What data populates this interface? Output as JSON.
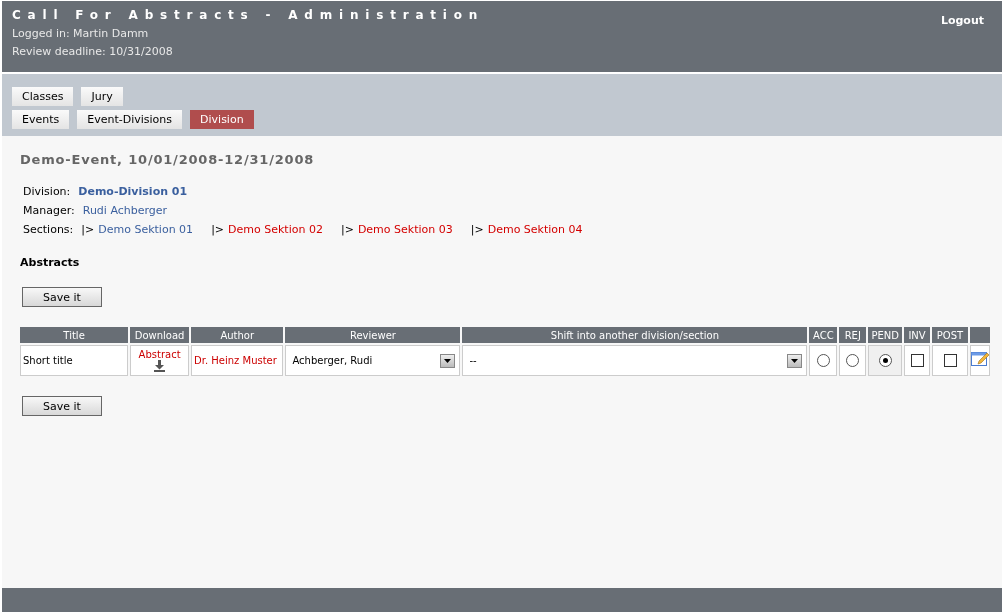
{
  "header": {
    "title": "Call For Abstracts - Administration",
    "logged_in": "Logged in: Martin Damm",
    "deadline": "Review deadline: 10/31/2008",
    "logout": "Logout"
  },
  "nav": [
    [
      {
        "label": "Classes",
        "selected": false
      },
      {
        "label": "Jury",
        "selected": false
      }
    ],
    [
      {
        "label": "Events",
        "selected": false
      },
      {
        "label": "Event-Divisions",
        "selected": false
      },
      {
        "label": "Division",
        "selected": true
      }
    ]
  ],
  "event_title": "Demo-Event, 10/01/2008-12/31/2008",
  "division": {
    "label": "Division:",
    "value": "Demo-Division 01"
  },
  "manager": {
    "label": "Manager:",
    "value": "Rudi Achberger"
  },
  "sections": {
    "label": "Sections:",
    "items": [
      {
        "marker": "|>",
        "name": "Demo Sektion 01",
        "color": "#3a5f9e"
      },
      {
        "marker": "|>",
        "name": "Demo Sektion 02",
        "color": "#d40000"
      },
      {
        "marker": "|>",
        "name": "Demo Sektion 03",
        "color": "#d40000"
      },
      {
        "marker": "|>",
        "name": "Demo Sektion 04",
        "color": "#d40000"
      }
    ]
  },
  "abstracts_heading": "Abstracts",
  "save_top": "Save it",
  "table": {
    "columns": [
      "Title",
      "Download",
      "Author",
      "Reviewer",
      "Shift into another division/section",
      "ACC",
      "REJ",
      "PEND",
      "INV",
      "POST"
    ],
    "rows": [
      {
        "title": "Short title",
        "download": "Abstract",
        "author": "Dr. Heinz Muster",
        "reviewer": "Achberger, Rudi",
        "shift": "--",
        "decisions": [
          {
            "kind": "radio",
            "selected": false
          },
          {
            "kind": "radio",
            "selected": false
          },
          {
            "kind": "radio",
            "selected": true
          },
          {
            "kind": "checkbox",
            "checked": false
          },
          {
            "kind": "checkbox",
            "checked": false
          }
        ]
      }
    ]
  },
  "save_bottom": "Save it"
}
